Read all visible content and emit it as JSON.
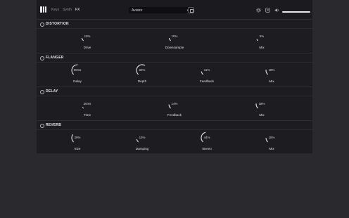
{
  "header": {
    "tabs": [
      {
        "label": "Keys",
        "active": false
      },
      {
        "label": "Synth",
        "active": false
      },
      {
        "label": "FX",
        "active": true
      }
    ],
    "preset": {
      "label": "Aviator"
    },
    "volume": 1.0
  },
  "sections": [
    {
      "title": "DISTORTION",
      "knobs": [
        {
          "label": "Drive",
          "value": "10%",
          "level": 0.1
        },
        {
          "label": "Downsample",
          "value": "10%",
          "level": 0.1
        },
        {
          "label": "Mix",
          "value": "5%",
          "level": 0.05
        }
      ]
    },
    {
      "title": "FLANGER",
      "knobs": [
        {
          "label": "Delay",
          "value": "50ms",
          "level": 0.5
        },
        {
          "label": "Depth",
          "value": "60%",
          "level": 0.6
        },
        {
          "label": "Feedback",
          "value": "11%",
          "level": 0.11
        },
        {
          "label": "Mix",
          "value": "18%",
          "level": 0.18
        }
      ]
    },
    {
      "title": "DELAY",
      "knobs": [
        {
          "label": "Time",
          "value": "30ms",
          "level": 0.03
        },
        {
          "label": "Feedback",
          "value": "14%",
          "level": 0.14
        },
        {
          "label": "Mix",
          "value": "18%",
          "level": 0.18
        }
      ]
    },
    {
      "title": "REVERB",
      "knobs": [
        {
          "label": "Size",
          "value": "29%",
          "level": 0.29
        },
        {
          "label": "Damping",
          "value": "10%",
          "level": 0.1
        },
        {
          "label": "Stereo",
          "value": "44%",
          "level": 0.44
        },
        {
          "label": "Mix",
          "value": "15%",
          "level": 0.15
        }
      ]
    }
  ]
}
